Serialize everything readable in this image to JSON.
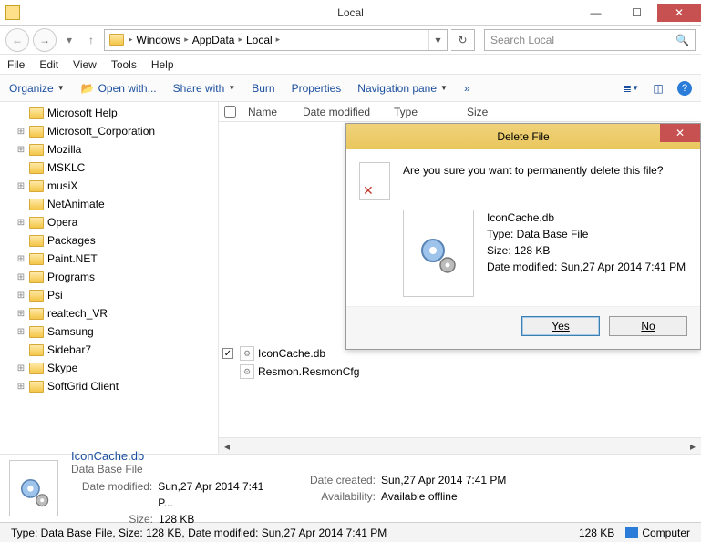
{
  "window": {
    "title": "Local"
  },
  "breadcrumb": [
    "Windows",
    "AppData",
    "Local"
  ],
  "search": {
    "placeholder": "Search Local"
  },
  "menu": [
    "File",
    "Edit",
    "View",
    "Tools",
    "Help"
  ],
  "toolbar": {
    "organize": "Organize",
    "openwith": "Open with...",
    "sharewith": "Share with",
    "burn": "Burn",
    "properties": "Properties",
    "navpane": "Navigation pane",
    "more": "»"
  },
  "columns": {
    "name": "Name",
    "modified": "Date modified",
    "type": "Type",
    "size": "Size"
  },
  "tree": [
    {
      "exp": "",
      "label": "Microsoft Help"
    },
    {
      "exp": "+",
      "label": "Microsoft_Corporation"
    },
    {
      "exp": "+",
      "label": "Mozilla"
    },
    {
      "exp": "",
      "label": "MSKLC"
    },
    {
      "exp": "+",
      "label": "musiX"
    },
    {
      "exp": "",
      "label": "NetAnimate"
    },
    {
      "exp": "+",
      "label": "Opera"
    },
    {
      "exp": "",
      "label": "Packages"
    },
    {
      "exp": "+",
      "label": "Paint.NET"
    },
    {
      "exp": "+",
      "label": "Programs"
    },
    {
      "exp": "+",
      "label": "Psi"
    },
    {
      "exp": "+",
      "label": "realtech_VR"
    },
    {
      "exp": "+",
      "label": "Samsung"
    },
    {
      "exp": "",
      "label": "Sidebar7"
    },
    {
      "exp": "+",
      "label": "Skype"
    },
    {
      "exp": "+",
      "label": "SoftGrid Client"
    }
  ],
  "files": [
    {
      "checked": true,
      "name": "IconCache.db"
    },
    {
      "checked": false,
      "name": "Resmon.ResmonCfg"
    }
  ],
  "dialog": {
    "title": "Delete File",
    "question": "Are you sure you want to permanently delete this file?",
    "filename": "IconCache.db",
    "type_line": "Type: Data Base File",
    "size_line": "Size: 128 KB",
    "modified_line": "Date modified: Sun,27 Apr 2014 7:41 PM",
    "yes": "Yes",
    "no": "No"
  },
  "details": {
    "filename": "IconCache.db",
    "filetype": "Data Base File",
    "modified_label": "Date modified:",
    "modified_value": "Sun,27 Apr 2014 7:41 P...",
    "size_label": "Size:",
    "size_value": "128 KB",
    "created_label": "Date created:",
    "created_value": "Sun,27 Apr 2014 7:41 PM",
    "avail_label": "Availability:",
    "avail_value": "Available offline"
  },
  "status": {
    "summary": "Type: Data Base File, Size: 128 KB, Date modified: Sun,27 Apr 2014 7:41 PM",
    "size": "128 KB",
    "computer": "Computer"
  }
}
